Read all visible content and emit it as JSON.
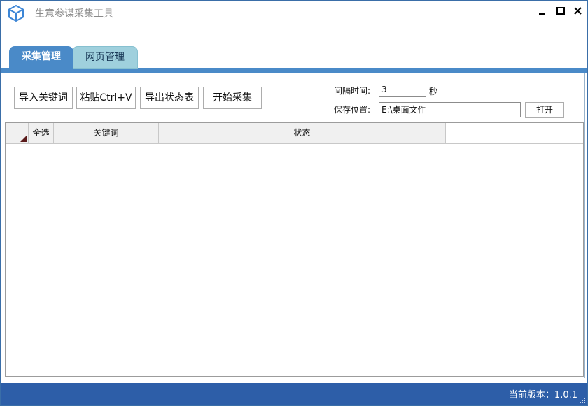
{
  "window": {
    "title": "生意参谋采集工具",
    "app_icon": "cube-icon",
    "controls": [
      "minimize-icon",
      "maximize-icon",
      "close-icon"
    ]
  },
  "tabs": [
    {
      "label": "采集管理",
      "active": true
    },
    {
      "label": "网页管理",
      "active": false
    }
  ],
  "toolbar": {
    "import_label": "导入关键词",
    "paste_label": "粘贴Ctrl+V",
    "export_label": "导出状态表",
    "start_label": "开始采集"
  },
  "settings": {
    "interval_label": "间隔时间:",
    "interval_value": "3",
    "interval_unit": "秒",
    "save_label": "保存位置:",
    "save_value": "E:\\桌面文件",
    "open_label": "打开"
  },
  "grid": {
    "columns": [
      "全选",
      "关键词",
      "状态"
    ],
    "rows": []
  },
  "statusbar": {
    "version_text": "当前版本：1.0.1"
  },
  "colors": {
    "accent": "#4a8ac8",
    "statusbar": "#2d5ea8",
    "inactive_tab": "#9fd0dd"
  }
}
